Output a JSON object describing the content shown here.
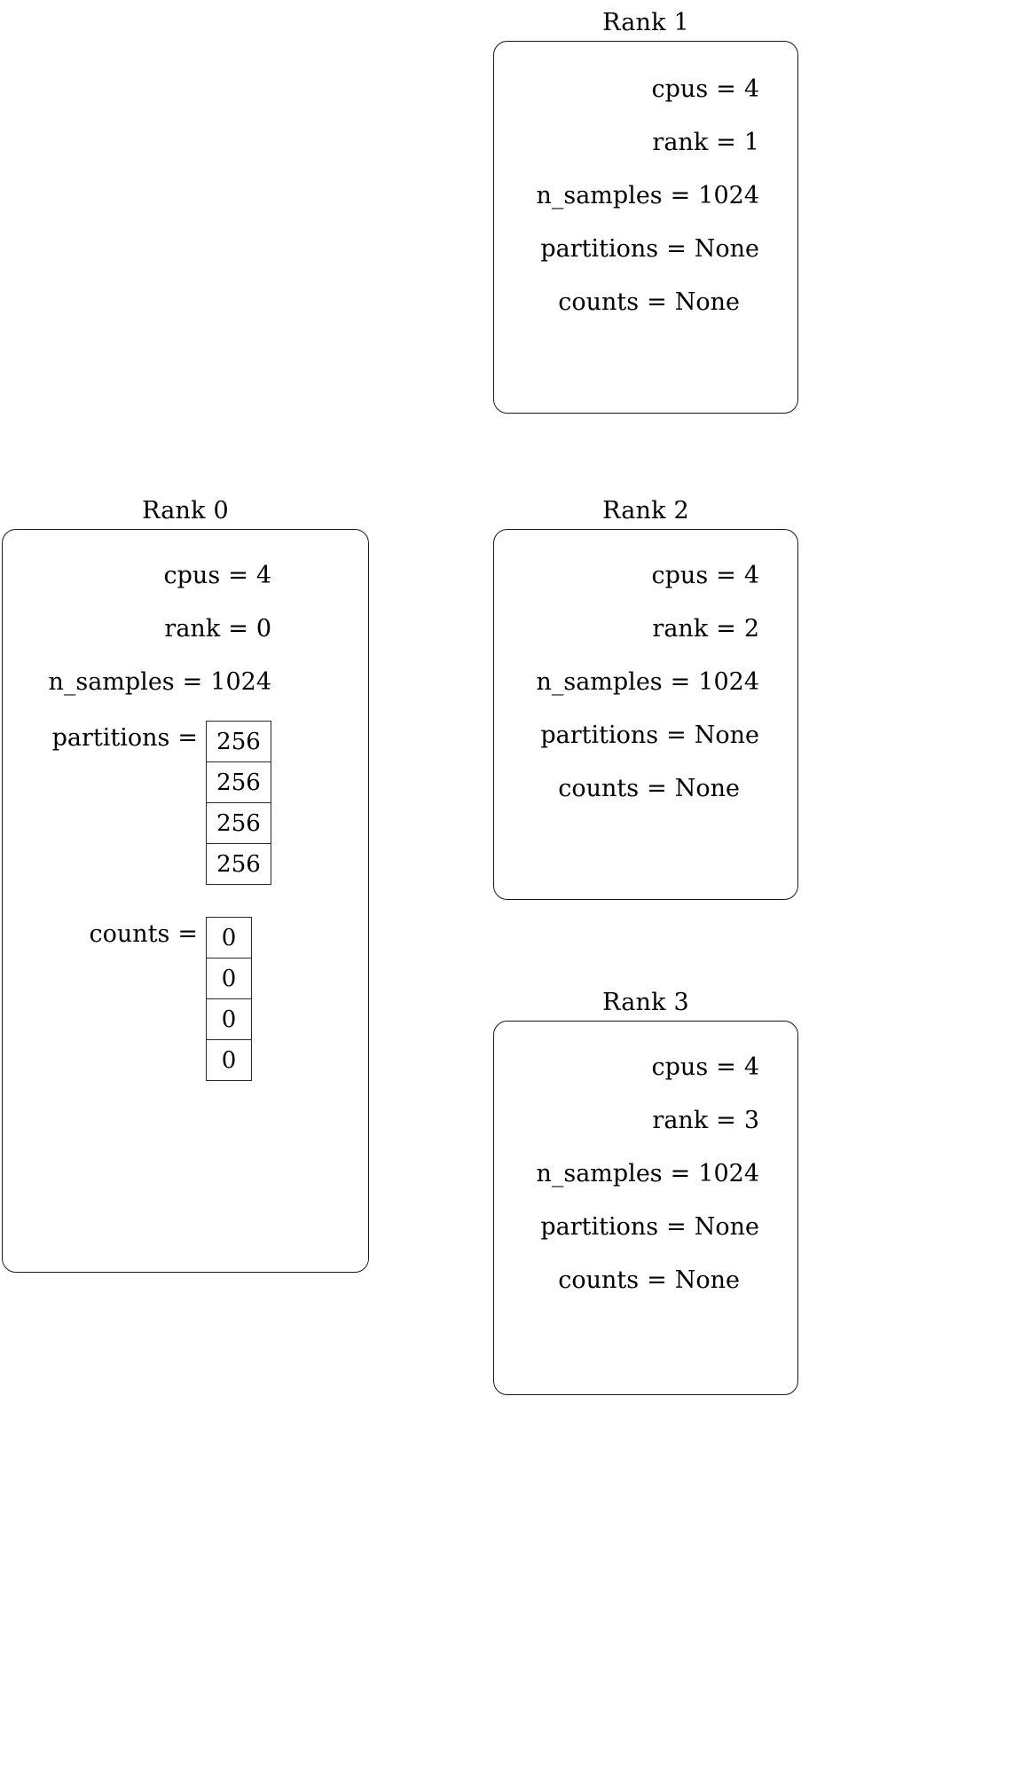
{
  "diagram": {
    "title_prefix": "Rank",
    "field_labels": {
      "cpus": "cpus",
      "rank": "rank",
      "n_samples": "n_samples",
      "partitions": "partitions",
      "counts": "counts"
    },
    "equals": "=",
    "none_value": "None",
    "stroke_color": "#1a1a1a",
    "background_color": "#ffffff",
    "text_color": "#000000"
  },
  "ranks": [
    {
      "title": "Rank 0",
      "cpus_label": "cpus",
      "cpus_value": "4",
      "rank_label": "rank",
      "rank_value": "0",
      "n_samples_label": "n_samples",
      "n_samples_value": "1024",
      "partitions_label": "partitions",
      "partitions_value": null,
      "partitions_array": [
        "256",
        "256",
        "256",
        "256"
      ],
      "counts_label": "counts",
      "counts_value": null,
      "counts_array": [
        "0",
        "0",
        "0",
        "0"
      ]
    },
    {
      "title": "Rank 1",
      "cpus_label": "cpus",
      "cpus_value": "4",
      "rank_label": "rank",
      "rank_value": "1",
      "n_samples_label": "n_samples",
      "n_samples_value": "1024",
      "partitions_label": "partitions",
      "partitions_value": "None",
      "partitions_array": null,
      "counts_label": "counts",
      "counts_value": "None",
      "counts_array": null
    },
    {
      "title": "Rank 2",
      "cpus_label": "cpus",
      "cpus_value": "4",
      "rank_label": "rank",
      "rank_value": "2",
      "n_samples_label": "n_samples",
      "n_samples_value": "1024",
      "partitions_label": "partitions",
      "partitions_value": "None",
      "partitions_array": null,
      "counts_label": "counts",
      "counts_value": "None",
      "counts_array": null
    },
    {
      "title": "Rank 3",
      "cpus_label": "cpus",
      "cpus_value": "4",
      "rank_label": "rank",
      "rank_value": "3",
      "n_samples_label": "n_samples",
      "n_samples_value": "1024",
      "partitions_label": "partitions",
      "partitions_value": "None",
      "partitions_array": null,
      "counts_label": "counts",
      "counts_value": "None",
      "counts_array": null
    }
  ]
}
